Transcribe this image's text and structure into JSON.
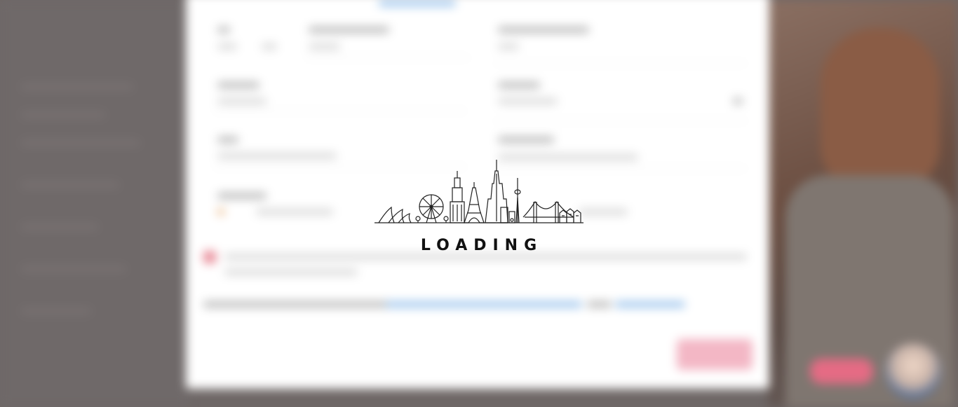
{
  "loader": {
    "text": "LOADING",
    "icon": "city-skyline-icon",
    "color": "#111111"
  },
  "background": {
    "state": "blurred",
    "accent_pink": "#e56b84",
    "link_blue": "#9cc4ec"
  }
}
